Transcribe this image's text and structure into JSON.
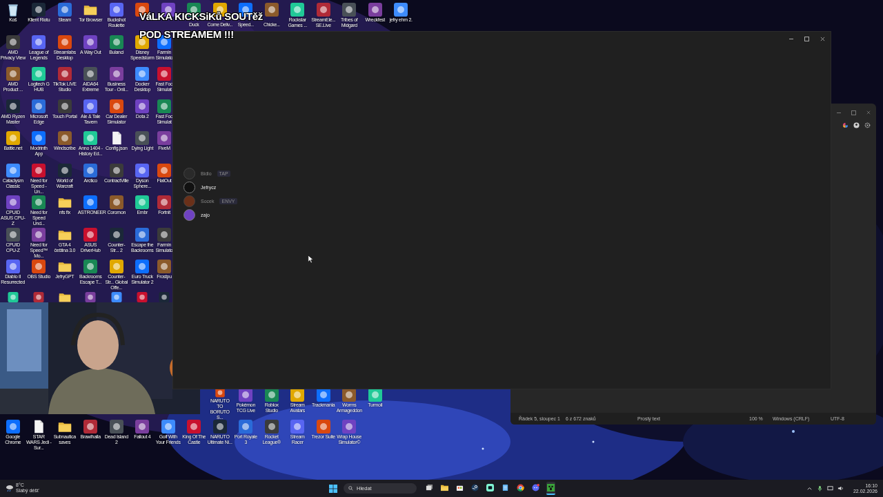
{
  "overlay_text": {
    "lines": [
      "VáLKA KICKSiKů SOUTěž",
      "POD STREAMEM !!!"
    ]
  },
  "desktop": {
    "top_row": [
      {
        "kind": "bin",
        "label": "Koš"
      },
      {
        "kind": "app",
        "label": "Klient Riotu"
      },
      {
        "kind": "app",
        "label": "Steam"
      },
      {
        "kind": "folder",
        "label": "Tor Browser"
      },
      {
        "kind": "app",
        "label": "Buckshot Roulette"
      },
      {
        "kind": "app"
      },
      {
        "kind": "app"
      },
      {
        "kind": "app",
        "label": "Duck",
        "covered": true
      },
      {
        "kind": "app",
        "label": "Come Deliv...",
        "covered": true
      },
      {
        "kind": "app",
        "label": "Speed...",
        "covered": true
      },
      {
        "kind": "app",
        "label": "Chicke...",
        "covered": true
      },
      {
        "kind": "app",
        "label": "Rockstar Games ..."
      },
      {
        "kind": "app",
        "label": "StreamEle... SE.Live"
      },
      {
        "kind": "app",
        "label": "Tribes of Midgard"
      },
      {
        "kind": "app",
        "label": "Wreckfest"
      },
      {
        "kind": "app",
        "label": "jefry ehm 2."
      }
    ],
    "left_block": [
      [
        {
          "kind": "app",
          "label": "AMD Privacy View"
        },
        {
          "kind": "app",
          "label": "League of Legends"
        },
        {
          "kind": "app",
          "label": "Streamlabs Desktop"
        },
        {
          "kind": "app",
          "label": "A Way Out"
        },
        {
          "kind": "app",
          "label": "Bulanci"
        },
        {
          "kind": "app",
          "label": "Disney Speedstorm"
        },
        {
          "kind": "app",
          "label": "Farmin Simulato"
        }
      ],
      [
        {
          "kind": "app",
          "label": "AMD Product ..."
        },
        {
          "kind": "app",
          "label": "Logitech G HUB"
        },
        {
          "kind": "app",
          "label": "TikTok LIVE Studio"
        },
        {
          "kind": "app",
          "label": "AIDA64 Extreme"
        },
        {
          "kind": "app",
          "label": "Business Tour - Onli..."
        },
        {
          "kind": "app",
          "label": "Docker Desktop"
        },
        {
          "kind": "app",
          "label": "Fast Foo Simulat"
        }
      ],
      [
        {
          "kind": "app",
          "label": "AMD Ryzen Master"
        },
        {
          "kind": "app",
          "label": "Microsoft Edge"
        },
        {
          "kind": "app",
          "label": "Touch Portal"
        },
        {
          "kind": "app",
          "label": "Ale & Tale Tavern"
        },
        {
          "kind": "app",
          "label": "Car Dealer Simulator"
        },
        {
          "kind": "app",
          "label": "Dota 2"
        },
        {
          "kind": "app",
          "label": "Fast Foo Simulat"
        }
      ],
      [
        {
          "kind": "app",
          "label": "Battle.net"
        },
        {
          "kind": "app",
          "label": "Modrinth App"
        },
        {
          "kind": "app",
          "label": "Windscribe"
        },
        {
          "kind": "app",
          "label": "Anno 1404 - History Ed..."
        },
        {
          "kind": "file",
          "label": "Config.json"
        },
        {
          "kind": "app",
          "label": "Dying Light"
        },
        {
          "kind": "app",
          "label": "FiveM"
        }
      ],
      [
        {
          "kind": "app",
          "label": "Cataclysm Classic"
        },
        {
          "kind": "app",
          "label": "Need for Speed - Un..."
        },
        {
          "kind": "app",
          "label": "World of Warcraft"
        },
        {
          "kind": "app",
          "label": "Arctico"
        },
        {
          "kind": "app",
          "label": "ContractVille"
        },
        {
          "kind": "app",
          "label": "Dyson Sphere..."
        },
        {
          "kind": "app",
          "label": "FlatOut"
        }
      ],
      [
        {
          "kind": "app",
          "label": "CPUID ASUS CPU-Z"
        },
        {
          "kind": "app",
          "label": "Need for Speed Und..."
        },
        {
          "kind": "folder",
          "label": "nfs fix"
        },
        {
          "kind": "app",
          "label": "ASTRONEER"
        },
        {
          "kind": "app",
          "label": "Coromon"
        },
        {
          "kind": "app",
          "label": "Embr"
        },
        {
          "kind": "app",
          "label": "Fortnit"
        }
      ],
      [
        {
          "kind": "app",
          "label": "CPUID CPU-Z"
        },
        {
          "kind": "app",
          "label": "Need for Speed™ Mo..."
        },
        {
          "kind": "folder",
          "label": "GTA 4 čeština 3.0"
        },
        {
          "kind": "app",
          "label": "ASUS DriverHub"
        },
        {
          "kind": "app",
          "label": "Counter-Str... 2"
        },
        {
          "kind": "app",
          "label": "Escape the Backrooms"
        },
        {
          "kind": "app",
          "label": "Farmin Simulato"
        }
      ],
      [
        {
          "kind": "app",
          "label": "Diablo II Resurrected"
        },
        {
          "kind": "app",
          "label": "OBS Studio"
        },
        {
          "kind": "folder",
          "label": "JefryGPT"
        },
        {
          "kind": "app",
          "label": "Backrooms Escape T..."
        },
        {
          "kind": "app",
          "label": "Counter-Str... Global Offe..."
        },
        {
          "kind": "app",
          "label": "Euro Truck Simulator 2"
        },
        {
          "kind": "app",
          "label": "Frostpu"
        }
      ],
      [
        {
          "kind": "app"
        },
        {
          "kind": "app"
        },
        {
          "kind": "folder"
        },
        {
          "kind": "app"
        },
        {
          "kind": "app"
        },
        {
          "kind": "app"
        },
        {
          "kind": "app"
        }
      ]
    ],
    "bottom_row_upper": [
      {
        "kind": "app",
        "label": "NARUTO TO BORUTO S..."
      },
      {
        "kind": "app",
        "label": "Pokémon TCG Live"
      },
      {
        "kind": "app",
        "label": "Roblox Studio"
      },
      {
        "kind": "app",
        "label": "Stream Avatars"
      },
      {
        "kind": "app",
        "label": "Trackmania"
      },
      {
        "kind": "app",
        "label": "Worms Armageddon"
      },
      {
        "kind": "app",
        "label": "Turmoil"
      }
    ],
    "bottom_row_lower": [
      {
        "kind": "app",
        "label": "Google Chrome"
      },
      {
        "kind": "file",
        "label": "STAR WARS Jedi - Sur..."
      },
      {
        "kind": "folder",
        "label": "Subnautica saves"
      },
      {
        "kind": "app",
        "label": "Brawlhalla"
      },
      {
        "kind": "app",
        "label": "Dead Island 2"
      },
      {
        "kind": "app",
        "label": "Fallout 4"
      },
      {
        "kind": "app",
        "label": "Golf With Your Friends"
      },
      {
        "kind": "app",
        "label": "King Of The Castle"
      },
      {
        "kind": "app",
        "label": "NARUTO Ultimate Ni..."
      },
      {
        "kind": "app",
        "label": "Port Royale 3"
      },
      {
        "kind": "app",
        "label": "Rocket League®"
      },
      {
        "kind": "app",
        "label": "Stream Racer"
      },
      {
        "kind": "app",
        "label": "Trezor Suite"
      },
      {
        "kind": "app",
        "label": "Wrap House Simulator©"
      }
    ]
  },
  "main_window": {
    "members": [
      {
        "name": "Bidlo",
        "dimmed": true,
        "badge": "TAP"
      },
      {
        "name": "Jefrycz",
        "dimmed": false
      },
      {
        "name": "Socek",
        "dimmed": true,
        "badge": "ENVY"
      },
      {
        "name": "zajo",
        "dimmed": false
      }
    ]
  },
  "notepad_status_bar": [
    "Řádek 5, sloupec 1",
    "6 z 672 znaků",
    "Prostý text",
    "100 %",
    "Windows (CRLF)",
    "UTF-8"
  ],
  "taskbar": {
    "weather": {
      "temperature": "8°C",
      "condition": "Slabý déšť"
    },
    "search": {
      "placeholder": "Hledat"
    },
    "apps": [
      {
        "kind": "taskview",
        "selected": false
      },
      {
        "kind": "explorer",
        "selected": false
      },
      {
        "kind": "store",
        "selected": false
      },
      {
        "kind": "steam",
        "selected": false
      },
      {
        "kind": "streamlabs",
        "selected": false
      },
      {
        "kind": "notepad",
        "selected": false
      },
      {
        "kind": "chrome",
        "selected": false
      },
      {
        "kind": "discord",
        "selected": false
      },
      {
        "kind": "minecraft",
        "selected": true
      }
    ],
    "time": "16:10",
    "date": "22.02.2026"
  }
}
